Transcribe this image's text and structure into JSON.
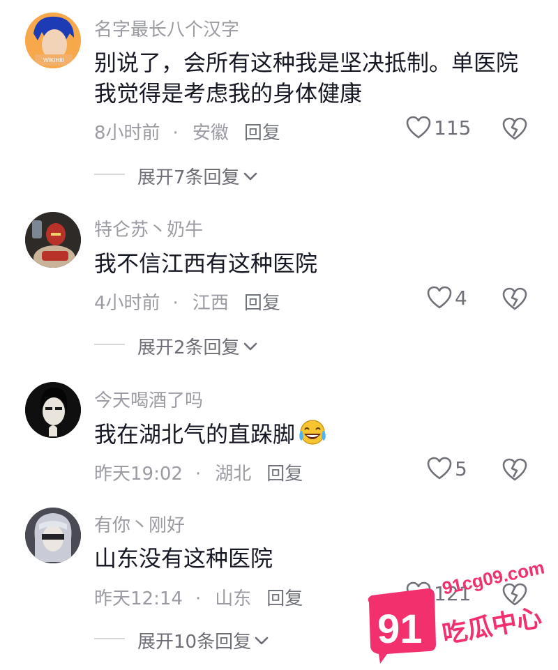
{
  "comments": [
    {
      "username": "名字最长八个汉字",
      "text": "别说了，会所有这种我是坚决抵制。单医院我觉得是考虑我的身体健康",
      "time": "8小时前",
      "location": "安徽",
      "reply_label": "回复",
      "likes": "115",
      "expand_label": "展开7条回复",
      "avatar_text": "WIKIHIII"
    },
    {
      "username": "特仑苏丶奶牛",
      "text": "我不信江西有这种医院",
      "time": "4小时前",
      "location": "江西",
      "reply_label": "回复",
      "likes": "4",
      "expand_label": "展开2条回复"
    },
    {
      "username": "今天喝酒了吗",
      "text": "我在湖北气的直跺脚",
      "time": "昨天19:02",
      "location": "湖北",
      "reply_label": "回复",
      "likes": "5"
    },
    {
      "username": "有你丶刚好",
      "text": "山东没有这种医院",
      "time": "昨天12:14",
      "location": "山东",
      "reply_label": "回复",
      "likes": "121",
      "expand_label": "展开10条回复"
    }
  ],
  "separator": "·",
  "watermark": {
    "url": "91cg09.com",
    "logo_number": "91",
    "logo_text": "吃瓜中心"
  },
  "icons": {
    "like": "heart-outline-icon",
    "dislike": "broken-heart-icon",
    "expand": "chevron-down-icon",
    "emoji": "laughing-crying-emoji"
  },
  "colors": {
    "watermark_pink": "#f2306e",
    "meta_gray": "#9b9ca3"
  }
}
